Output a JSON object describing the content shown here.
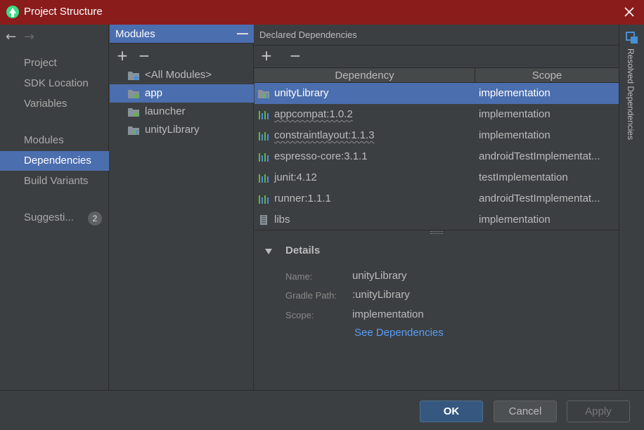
{
  "window": {
    "title": "Project Structure",
    "app_icon": "android-studio-icon",
    "close_icon": "close-icon"
  },
  "leftnav": {
    "back_icon": "arrow-left-icon",
    "forward_icon": "arrow-right-icon",
    "items": [
      {
        "label": "Project"
      },
      {
        "label": "SDK Location"
      },
      {
        "label": "Variables"
      },
      {
        "label": "Modules"
      },
      {
        "label": "Dependencies",
        "selected": true
      },
      {
        "label": "Build Variants"
      },
      {
        "label": "Suggesti...",
        "badge": "2"
      }
    ]
  },
  "modules": {
    "header": "Modules",
    "add_label": "+",
    "remove_label": "−",
    "items": [
      {
        "label": "<All Modules>",
        "icon": "all-modules-icon"
      },
      {
        "label": "app",
        "icon": "app-module-icon",
        "selected": true
      },
      {
        "label": "launcher",
        "icon": "module-folder-icon"
      },
      {
        "label": "unityLibrary",
        "icon": "library-module-icon"
      }
    ]
  },
  "dependencies": {
    "header": "Declared Dependencies",
    "add_label": "+",
    "remove_label": "−",
    "columns": [
      "Dependency",
      "Scope"
    ],
    "rows": [
      {
        "name": "unityLibrary",
        "scope": "implementation",
        "icon": "module-dependency-icon",
        "selected": true
      },
      {
        "name": "appcompat:1.0.2",
        "scope": "implementation",
        "icon": "library-bars-icon",
        "squiggle": true
      },
      {
        "name": "constraintlayout:1.1.3",
        "scope": "implementation",
        "icon": "library-bars-icon",
        "squiggle": true
      },
      {
        "name": "espresso-core:3.1.1",
        "scope": "androidTestImplementat...",
        "icon": "library-bars-icon"
      },
      {
        "name": "junit:4.12",
        "scope": "testImplementation",
        "icon": "library-bars-icon"
      },
      {
        "name": "runner:1.1.1",
        "scope": "androidTestImplementat...",
        "icon": "library-bars-icon"
      },
      {
        "name": "libs",
        "scope": "implementation",
        "icon": "jar-file-icon"
      }
    ]
  },
  "details": {
    "title": "Details",
    "fields": [
      {
        "label": "Name:",
        "value": "unityLibrary"
      },
      {
        "label": "Gradle Path:",
        "value": ":unityLibrary"
      },
      {
        "label": "Scope:",
        "value": "implementation"
      }
    ],
    "link": "See Dependencies"
  },
  "right_panel": {
    "label": "Resolved Dependencies",
    "icon": "resolved-dependencies-icon"
  },
  "footer": {
    "ok": "OK",
    "cancel": "Cancel",
    "apply": "Apply"
  },
  "colors": {
    "title_bar": "#8b1c1c",
    "selection": "#4b6eaf",
    "link": "#589df6",
    "ok_button": "#365880"
  }
}
